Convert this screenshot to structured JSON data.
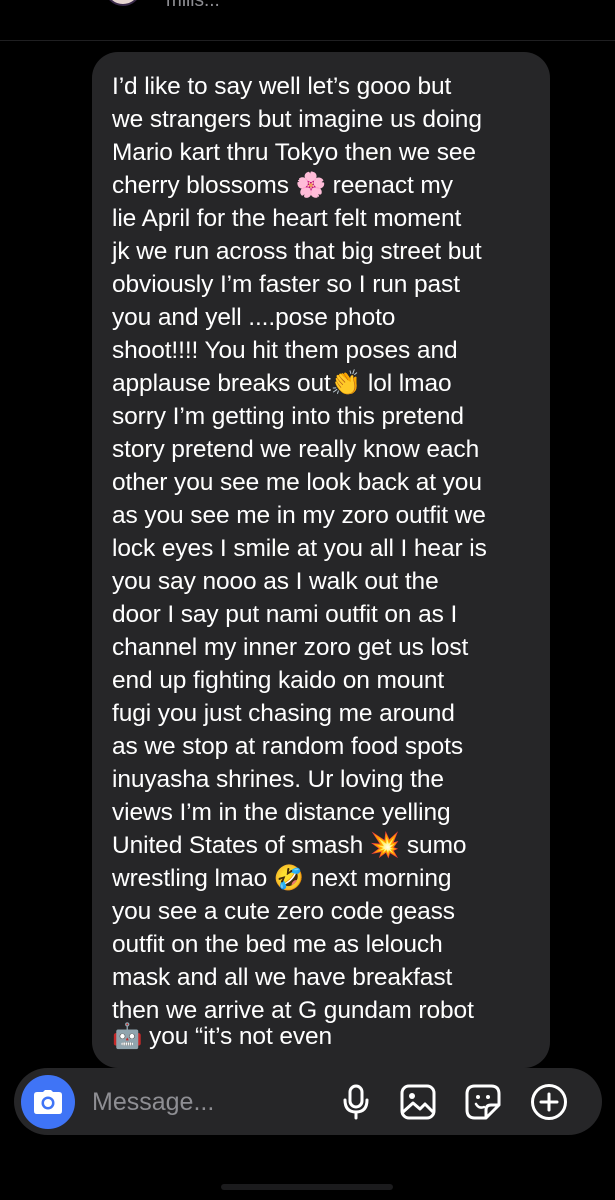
{
  "header": {
    "name_fragment": "mills..."
  },
  "message": {
    "lines": [
      "I’d like to say well let’s gooo but",
      "we strangers but imagine us doing",
      "Mario kart thru Tokyo then we see",
      "cherry blossoms 🌸 reenact my",
      "lie April for the heart felt moment",
      "jk we run across that big street but",
      "obviously I’m faster so I run past",
      "you and yell ....pose photo",
      "shoot!!!! You hit them poses and",
      "applause breaks out👏  lol lmao",
      "sorry I’m getting into this pretend",
      "story pretend we really know each",
      "other you see me look back at you",
      "as you see me in my zoro outfit we",
      "lock eyes I smile at you all I hear is",
      "you say nooo as I walk out the",
      "door I say put nami outfit on as I",
      "channel my inner zoro get us lost",
      "end up fighting kaido on mount",
      "fugi you just chasing me around",
      "as we stop at random food spots",
      "inuyasha shrines. Ur loving the",
      "views I’m in the distance yelling",
      "United States of smash 💥 sumo",
      "wrestling lmao 🤣 next morning",
      "you see a cute zero code geass",
      "outfit on the bed me as lelouch",
      "mask and all we have breakfast",
      "then we arrive at G gundam robot",
      "🤖 you “it’s not even"
    ]
  },
  "composer": {
    "placeholder": "Message...",
    "icons": [
      "camera-icon",
      "microphone-icon",
      "image-icon",
      "sticker-icon",
      "plus-circle-icon"
    ]
  },
  "colors": {
    "background": "#000000",
    "bubble": "#262628",
    "camera_button": "#3f74f6",
    "placeholder": "#8e8e93"
  }
}
